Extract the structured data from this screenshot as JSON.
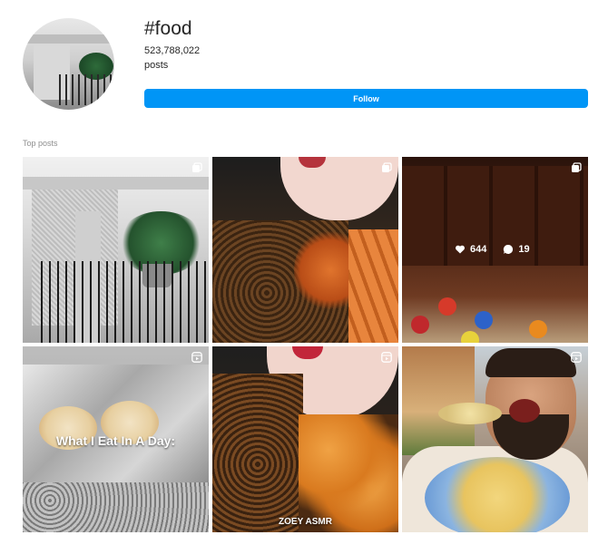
{
  "header": {
    "hashtag": "#food",
    "post_count": "523,788,022",
    "post_label": "posts",
    "follow_label": "Follow"
  },
  "section": {
    "title": "Top posts"
  },
  "posts": [
    {
      "type_icon": "multiple-images-icon"
    },
    {
      "type_icon": "multiple-images-icon"
    },
    {
      "type_icon": "multiple-images-icon",
      "likes": "644",
      "comments": "19"
    },
    {
      "type_icon": "reel-icon",
      "caption": "What I Eat In A Day:"
    },
    {
      "type_icon": "reel-icon",
      "caption": "ZOEY ASMR"
    },
    {
      "type_icon": "reel-icon"
    }
  ],
  "colors": {
    "accent": "#0095f6",
    "text": "#262626",
    "muted": "#8e8e8e"
  }
}
